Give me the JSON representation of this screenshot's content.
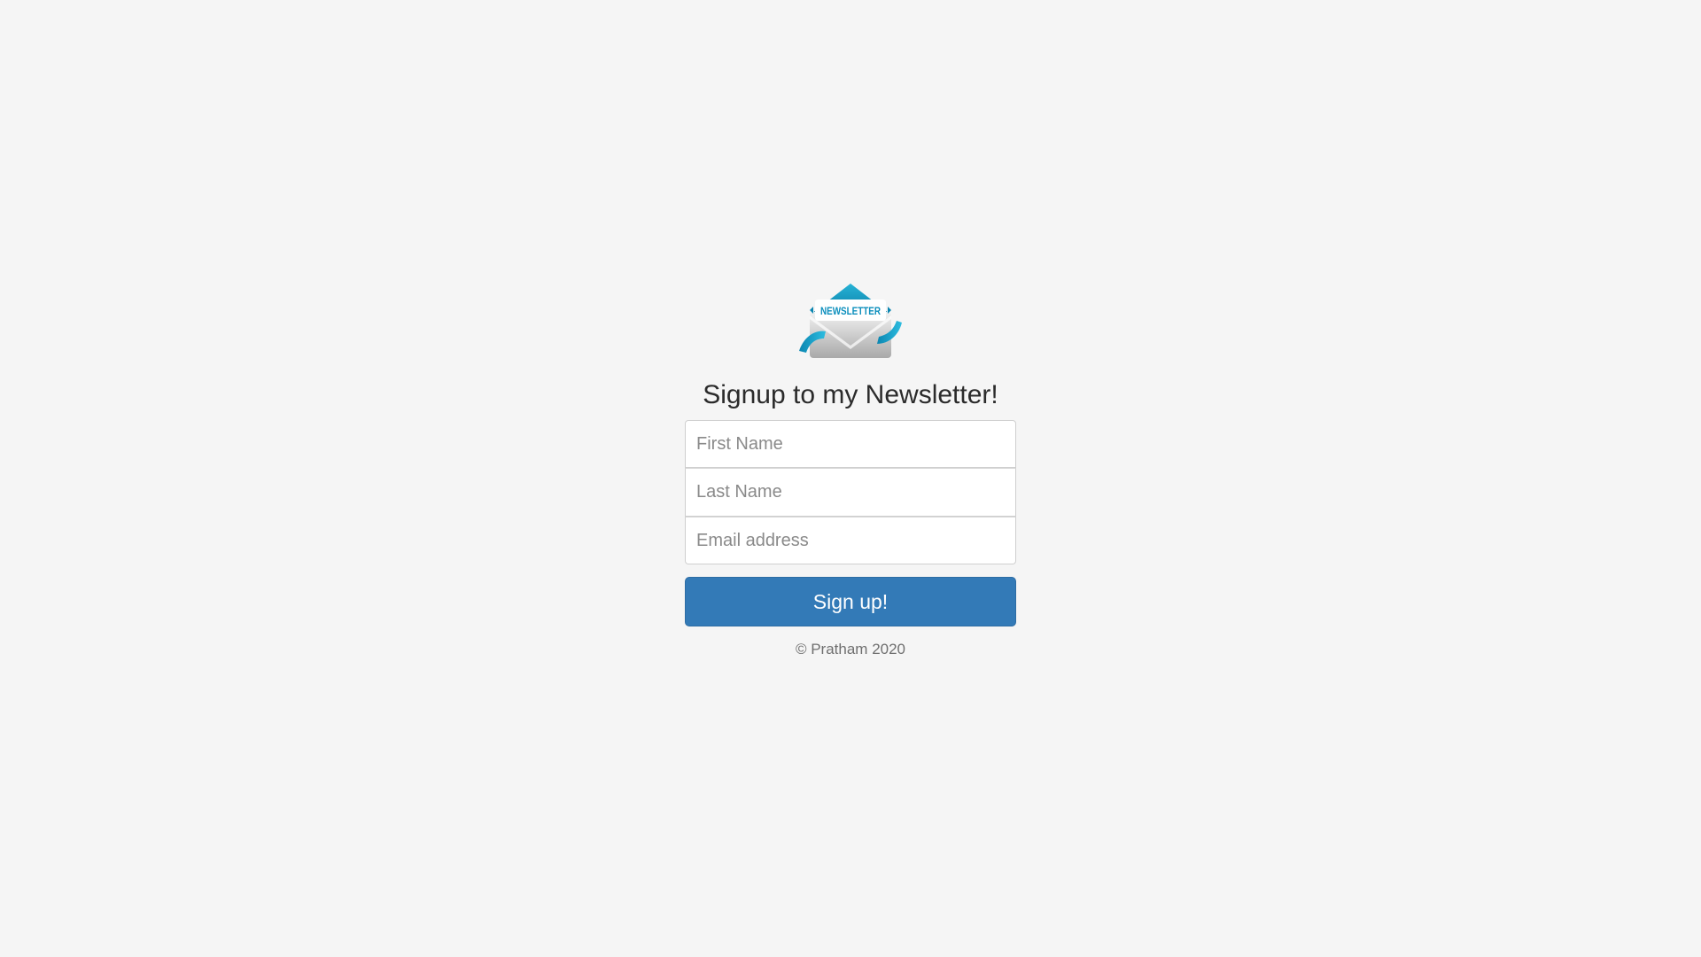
{
  "logo": {
    "text": "NEWSLETTER",
    "icon": "newsletter-envelope-icon",
    "colors": {
      "primary": "#1aa3c7",
      "dark": "#0b6f97",
      "envelope": "#d9d9d9"
    }
  },
  "form": {
    "heading": "Signup to my Newsletter!",
    "first_name_placeholder": "First Name",
    "last_name_placeholder": "Last Name",
    "email_placeholder": "Email address",
    "submit_label": "Sign up!"
  },
  "footer": {
    "copyright": "© Pratham 2020"
  },
  "theme": {
    "background": "#f5f5f5",
    "button": "#337ab7"
  }
}
